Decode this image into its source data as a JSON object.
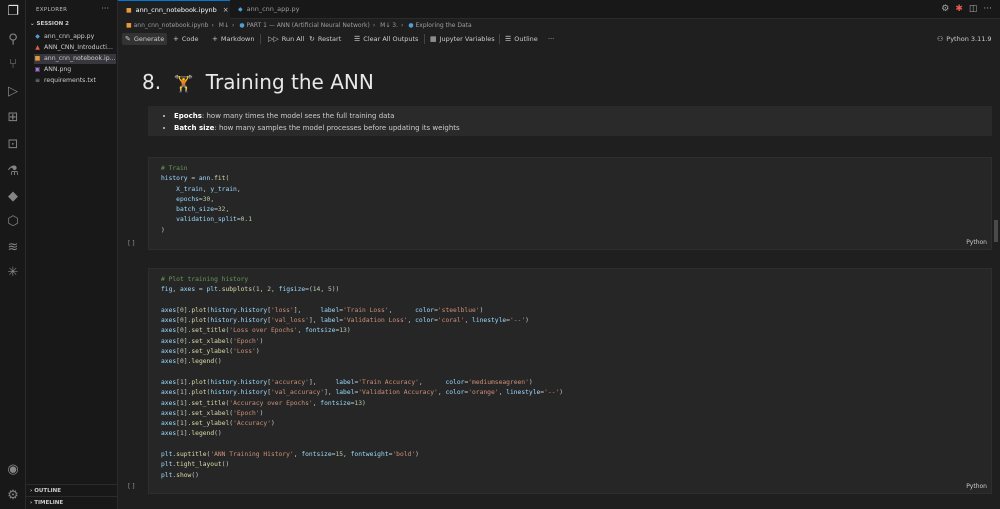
{
  "activity_icons": [
    "files-icon",
    "search-icon",
    "source-control-icon",
    "run-debug-icon",
    "extensions-icon",
    "remote-icon",
    "testing-icon",
    "python-icon",
    "packages-icon",
    "waves-icon",
    "sparkle-icon",
    "account-icon",
    "gear-icon"
  ],
  "sidebar": {
    "header": "EXPLORER",
    "section": "SESSION 2",
    "files": [
      {
        "name": "ann_cnn_app.py",
        "type": "py"
      },
      {
        "name": "ANN_CNN_Introducti...",
        "type": "pdf"
      },
      {
        "name": "ann_cnn_notebook.ip...",
        "type": "nb"
      },
      {
        "name": "ANN.png",
        "type": "img"
      },
      {
        "name": "requirements.txt",
        "type": "txt"
      }
    ],
    "outline": "OUTLINE",
    "timeline": "TIMELINE"
  },
  "tabs": [
    {
      "label": "ann_cnn_notebook.ipynb",
      "active": true
    },
    {
      "label": "ann_cnn_app.py",
      "active": false
    }
  ],
  "breadcrumb": [
    "ann_cnn_notebook.ipynb",
    "M↓",
    "PART 1 — ANN (Artificial Neural Network)",
    "M↓ 3.",
    "Exploring the Data"
  ],
  "toolbar": {
    "generate": "Generate",
    "code": "Code",
    "markdown": "Markdown",
    "run_all": "Run All",
    "restart": "Restart",
    "clear_outputs": "Clear All Outputs",
    "variables": "Jupyter Variables",
    "outline": "Outline",
    "more": "···",
    "kernel": "Python 3.11.9"
  },
  "notebook": {
    "heading_num": "8.",
    "heading_text": "Training the ANN",
    "bullets": [
      {
        "term": "Epochs",
        "desc": ": how many times the model sees the full training data"
      },
      {
        "term": "Batch size",
        "desc": ": how many samples the model processes before updating its weights"
      }
    ],
    "cell1_lang": "Python",
    "cell2_lang": "Python",
    "exec_label": "[ ]"
  },
  "colors": {
    "accent": "#0078d4",
    "editor_bg": "#1f1f1f",
    "cell_bg": "#262626",
    "comment": "#6a9955",
    "string": "#ce9178"
  }
}
